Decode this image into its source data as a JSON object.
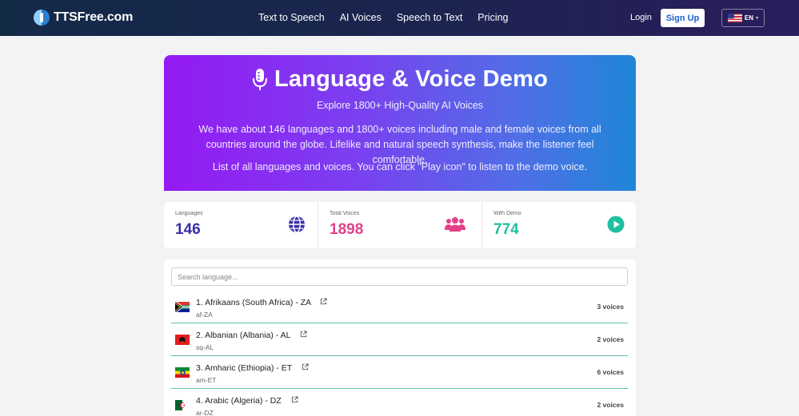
{
  "brand": {
    "name": "TTSFree.com"
  },
  "nav": {
    "links": [
      "Text to Speech",
      "AI Voices",
      "Speech to Text",
      "Pricing"
    ],
    "login": "Login",
    "signup": "Sign Up",
    "language": "EN"
  },
  "hero": {
    "title": "Language & Voice Demo",
    "subtitle": "Explore 1800+ High-Quality AI Voices",
    "description": "We have about 146 languages and 1800+ voices including male and female voices from all countries around the globe. Lifelike and natural speech synthesis, make the listener feel comfortable.",
    "note": "List of all languages and voices. You can click \"Play icon\" to listen to the demo voice."
  },
  "stats": [
    {
      "label": "Languages",
      "value": "146",
      "color": "#3b2fa8",
      "icon": "globe-icon"
    },
    {
      "label": "Total Voices",
      "value": "1898",
      "color": "#e3408a",
      "icon": "users-icon"
    },
    {
      "label": "With Demo",
      "value": "774",
      "color": "#1fbfa0",
      "icon": "play-circle-icon"
    }
  ],
  "search": {
    "placeholder": "Search language..."
  },
  "languages": [
    {
      "name": "1. Afrikaans (South Africa) - ZA",
      "code": "af-ZA",
      "voices": "3 voices",
      "flag": "za"
    },
    {
      "name": "2. Albanian (Albania) - AL",
      "code": "sq-AL",
      "voices": "2 voices",
      "flag": "al"
    },
    {
      "name": "3. Amharic (Ethiopia) - ET",
      "code": "am-ET",
      "voices": "6 voices",
      "flag": "et"
    },
    {
      "name": "4. Arabic (Algeria) - DZ",
      "code": "ar-DZ",
      "voices": "2 voices",
      "flag": "dz"
    }
  ]
}
